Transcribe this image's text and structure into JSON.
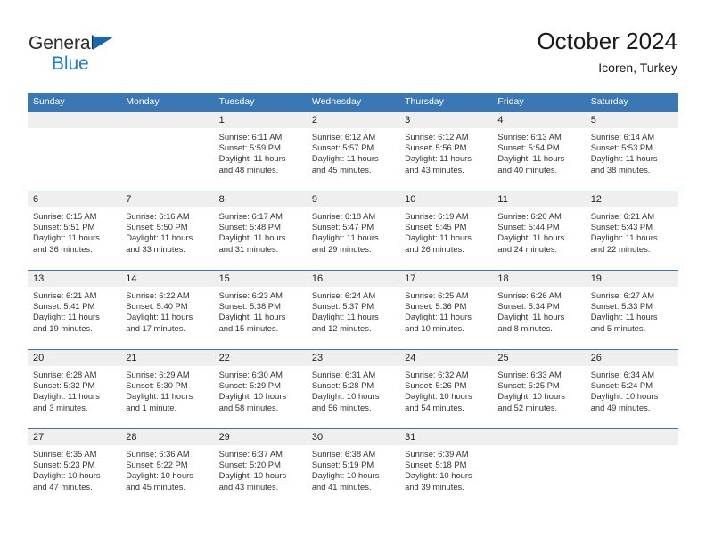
{
  "brand": {
    "name_part1": "General",
    "name_part2": "Blue",
    "triangle_color": "#1667b0",
    "blue_color": "#1f7fd0"
  },
  "header": {
    "title": "October 2024",
    "subtitle": "Icoren, Turkey"
  },
  "theme": {
    "header_blue": "#3978b5",
    "daynum_band": "#efefef",
    "text": "#333333"
  },
  "weekdays": [
    "Sunday",
    "Monday",
    "Tuesday",
    "Wednesday",
    "Thursday",
    "Friday",
    "Saturday"
  ],
  "weeks": [
    {
      "days": [
        {
          "num": "",
          "lines": [
            "",
            "",
            "",
            ""
          ]
        },
        {
          "num": "",
          "lines": [
            "",
            "",
            "",
            ""
          ]
        },
        {
          "num": "1",
          "lines": [
            "Sunrise: 6:11 AM",
            "Sunset: 5:59 PM",
            "Daylight: 11 hours",
            "and 48 minutes."
          ]
        },
        {
          "num": "2",
          "lines": [
            "Sunrise: 6:12 AM",
            "Sunset: 5:57 PM",
            "Daylight: 11 hours",
            "and 45 minutes."
          ]
        },
        {
          "num": "3",
          "lines": [
            "Sunrise: 6:12 AM",
            "Sunset: 5:56 PM",
            "Daylight: 11 hours",
            "and 43 minutes."
          ]
        },
        {
          "num": "4",
          "lines": [
            "Sunrise: 6:13 AM",
            "Sunset: 5:54 PM",
            "Daylight: 11 hours",
            "and 40 minutes."
          ]
        },
        {
          "num": "5",
          "lines": [
            "Sunrise: 6:14 AM",
            "Sunset: 5:53 PM",
            "Daylight: 11 hours",
            "and 38 minutes."
          ]
        }
      ]
    },
    {
      "days": [
        {
          "num": "6",
          "lines": [
            "Sunrise: 6:15 AM",
            "Sunset: 5:51 PM",
            "Daylight: 11 hours",
            "and 36 minutes."
          ]
        },
        {
          "num": "7",
          "lines": [
            "Sunrise: 6:16 AM",
            "Sunset: 5:50 PM",
            "Daylight: 11 hours",
            "and 33 minutes."
          ]
        },
        {
          "num": "8",
          "lines": [
            "Sunrise: 6:17 AM",
            "Sunset: 5:48 PM",
            "Daylight: 11 hours",
            "and 31 minutes."
          ]
        },
        {
          "num": "9",
          "lines": [
            "Sunrise: 6:18 AM",
            "Sunset: 5:47 PM",
            "Daylight: 11 hours",
            "and 29 minutes."
          ]
        },
        {
          "num": "10",
          "lines": [
            "Sunrise: 6:19 AM",
            "Sunset: 5:45 PM",
            "Daylight: 11 hours",
            "and 26 minutes."
          ]
        },
        {
          "num": "11",
          "lines": [
            "Sunrise: 6:20 AM",
            "Sunset: 5:44 PM",
            "Daylight: 11 hours",
            "and 24 minutes."
          ]
        },
        {
          "num": "12",
          "lines": [
            "Sunrise: 6:21 AM",
            "Sunset: 5:43 PM",
            "Daylight: 11 hours",
            "and 22 minutes."
          ]
        }
      ]
    },
    {
      "days": [
        {
          "num": "13",
          "lines": [
            "Sunrise: 6:21 AM",
            "Sunset: 5:41 PM",
            "Daylight: 11 hours",
            "and 19 minutes."
          ]
        },
        {
          "num": "14",
          "lines": [
            "Sunrise: 6:22 AM",
            "Sunset: 5:40 PM",
            "Daylight: 11 hours",
            "and 17 minutes."
          ]
        },
        {
          "num": "15",
          "lines": [
            "Sunrise: 6:23 AM",
            "Sunset: 5:38 PM",
            "Daylight: 11 hours",
            "and 15 minutes."
          ]
        },
        {
          "num": "16",
          "lines": [
            "Sunrise: 6:24 AM",
            "Sunset: 5:37 PM",
            "Daylight: 11 hours",
            "and 12 minutes."
          ]
        },
        {
          "num": "17",
          "lines": [
            "Sunrise: 6:25 AM",
            "Sunset: 5:36 PM",
            "Daylight: 11 hours",
            "and 10 minutes."
          ]
        },
        {
          "num": "18",
          "lines": [
            "Sunrise: 6:26 AM",
            "Sunset: 5:34 PM",
            "Daylight: 11 hours",
            "and 8 minutes."
          ]
        },
        {
          "num": "19",
          "lines": [
            "Sunrise: 6:27 AM",
            "Sunset: 5:33 PM",
            "Daylight: 11 hours",
            "and 5 minutes."
          ]
        }
      ]
    },
    {
      "days": [
        {
          "num": "20",
          "lines": [
            "Sunrise: 6:28 AM",
            "Sunset: 5:32 PM",
            "Daylight: 11 hours",
            "and 3 minutes."
          ]
        },
        {
          "num": "21",
          "lines": [
            "Sunrise: 6:29 AM",
            "Sunset: 5:30 PM",
            "Daylight: 11 hours",
            "and 1 minute."
          ]
        },
        {
          "num": "22",
          "lines": [
            "Sunrise: 6:30 AM",
            "Sunset: 5:29 PM",
            "Daylight: 10 hours",
            "and 58 minutes."
          ]
        },
        {
          "num": "23",
          "lines": [
            "Sunrise: 6:31 AM",
            "Sunset: 5:28 PM",
            "Daylight: 10 hours",
            "and 56 minutes."
          ]
        },
        {
          "num": "24",
          "lines": [
            "Sunrise: 6:32 AM",
            "Sunset: 5:26 PM",
            "Daylight: 10 hours",
            "and 54 minutes."
          ]
        },
        {
          "num": "25",
          "lines": [
            "Sunrise: 6:33 AM",
            "Sunset: 5:25 PM",
            "Daylight: 10 hours",
            "and 52 minutes."
          ]
        },
        {
          "num": "26",
          "lines": [
            "Sunrise: 6:34 AM",
            "Sunset: 5:24 PM",
            "Daylight: 10 hours",
            "and 49 minutes."
          ]
        }
      ]
    },
    {
      "days": [
        {
          "num": "27",
          "lines": [
            "Sunrise: 6:35 AM",
            "Sunset: 5:23 PM",
            "Daylight: 10 hours",
            "and 47 minutes."
          ]
        },
        {
          "num": "28",
          "lines": [
            "Sunrise: 6:36 AM",
            "Sunset: 5:22 PM",
            "Daylight: 10 hours",
            "and 45 minutes."
          ]
        },
        {
          "num": "29",
          "lines": [
            "Sunrise: 6:37 AM",
            "Sunset: 5:20 PM",
            "Daylight: 10 hours",
            "and 43 minutes."
          ]
        },
        {
          "num": "30",
          "lines": [
            "Sunrise: 6:38 AM",
            "Sunset: 5:19 PM",
            "Daylight: 10 hours",
            "and 41 minutes."
          ]
        },
        {
          "num": "31",
          "lines": [
            "Sunrise: 6:39 AM",
            "Sunset: 5:18 PM",
            "Daylight: 10 hours",
            "and 39 minutes."
          ]
        },
        {
          "num": "",
          "lines": [
            "",
            "",
            "",
            ""
          ]
        },
        {
          "num": "",
          "lines": [
            "",
            "",
            "",
            ""
          ]
        }
      ]
    }
  ]
}
